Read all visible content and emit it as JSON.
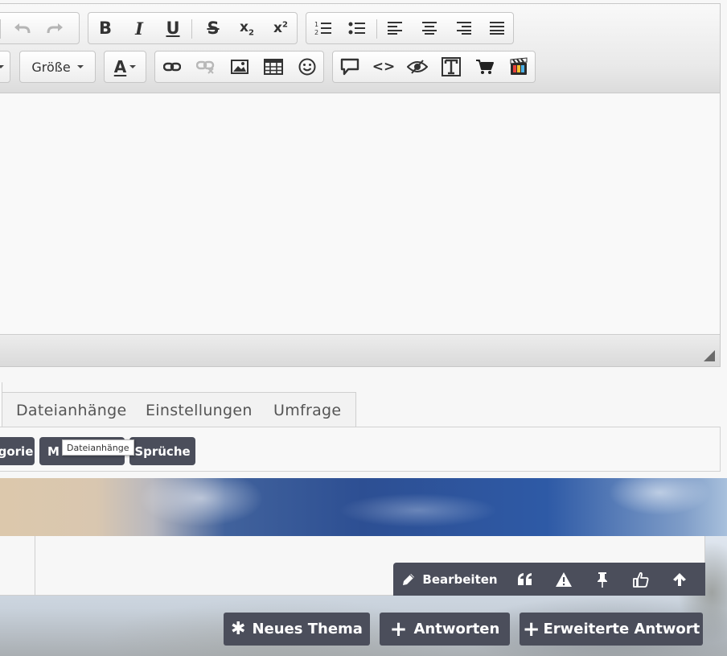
{
  "toolbar": {
    "row1": [
      {
        "name": "undo-icon",
        "glyph": "↶",
        "disabled": true
      },
      {
        "name": "redo-icon",
        "glyph": "↷",
        "disabled": true
      },
      {
        "name": "bold-icon",
        "glyph": "B"
      },
      {
        "name": "italic-icon",
        "glyph": "I"
      },
      {
        "name": "underline-icon",
        "glyph": "U"
      },
      {
        "name": "strikethrough-icon",
        "glyph": "S"
      },
      {
        "name": "subscript-icon",
        "glyph": "x₂"
      },
      {
        "name": "superscript-icon",
        "glyph": "x²"
      },
      {
        "name": "ordered-list-icon",
        "glyph": "≡"
      },
      {
        "name": "bullet-list-icon",
        "glyph": "≡"
      },
      {
        "name": "align-left-icon",
        "glyph": "≡"
      },
      {
        "name": "align-center-icon",
        "glyph": "≡"
      },
      {
        "name": "align-right-icon",
        "glyph": "≡"
      },
      {
        "name": "align-justify-icon",
        "glyph": "≡"
      }
    ],
    "size_label": "Größe",
    "font_color_label": "A",
    "row2_icons": [
      "link-icon",
      "unlink-icon",
      "image-icon",
      "table-icon",
      "emoji-icon",
      "quote-bubble-icon",
      "code-icon",
      "spoiler-icon",
      "text-icon",
      "cart-icon",
      "media-icon"
    ]
  },
  "tabs": {
    "attachments": "Dateianhänge",
    "settings": "Einstellungen",
    "poll": "Umfrage"
  },
  "panel_buttons": {
    "category_partial": "gorie",
    "more_partial": "M",
    "sayings": "Sprüche"
  },
  "tooltip": "Dateianhänge",
  "post_actions": {
    "edit": "Bearbeiten",
    "icons": [
      "quote-icon",
      "warning-icon",
      "pin-icon",
      "thumbs-up-icon",
      "arrow-up-icon"
    ]
  },
  "bottom_buttons": {
    "new_topic": "Neues Thema",
    "reply": "Antworten",
    "advanced_reply": "Erweiterte Antwort"
  },
  "colors": {
    "dark_button": "#4b4e5b",
    "background_sky": "#2d4f93"
  }
}
